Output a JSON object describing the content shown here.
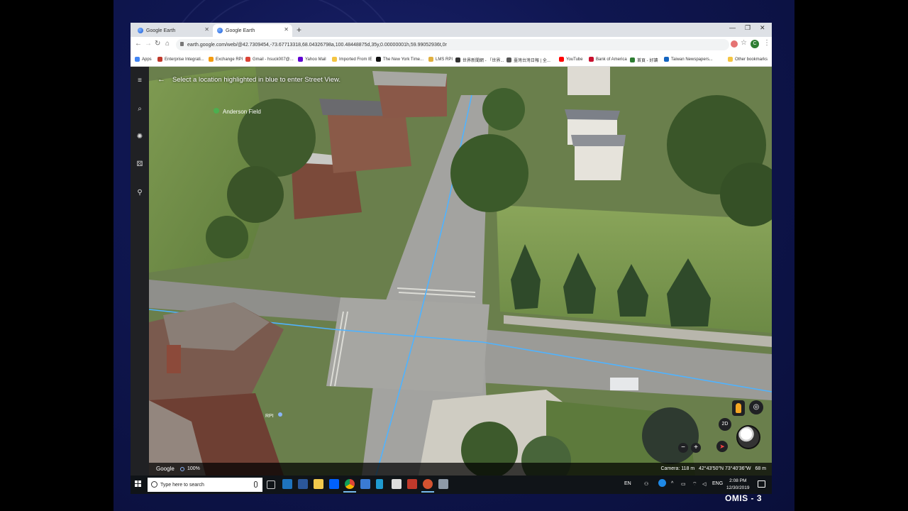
{
  "browser": {
    "tabs": [
      {
        "label": "Google Earth",
        "active": false
      },
      {
        "label": "Google Earth",
        "active": true
      }
    ],
    "url": "earth.google.com/web/@42.7309454,-73.67713318,68.04326798a,100.48448875d,35y,0.00000001h,59.99052936t,0r",
    "bookmarks": [
      {
        "label": "Apps",
        "color": "#4285f4"
      },
      {
        "label": "Enterprise Integrati...",
        "color": "#c0392b"
      },
      {
        "label": "Exchange RPI",
        "color": "#f39c12"
      },
      {
        "label": "Gmail - hsuck007@...",
        "color": "#db4437"
      },
      {
        "label": "Yahoo Mail",
        "color": "#6001d2"
      },
      {
        "label": "Imported From IE",
        "color": "#f4c542"
      },
      {
        "label": "The New York Time...",
        "color": "#111111"
      },
      {
        "label": "LMS RPI",
        "color": "#e0b040"
      },
      {
        "label": "世界新聞網 - 「世界...",
        "color": "#333333"
      },
      {
        "label": "臺灣台灣日報 | 全...",
        "color": "#555555"
      },
      {
        "label": "YouTube",
        "color": "#ff0000"
      },
      {
        "label": "Bank of America",
        "color": "#c8102e"
      },
      {
        "label": "首頁 - 好讀",
        "color": "#2e7d32"
      },
      {
        "label": "Taiwan Newspapers...",
        "color": "#1565c0"
      },
      {
        "label": "Other bookmarks",
        "color": "#f4c542"
      }
    ],
    "profile_initial": "C"
  },
  "earth": {
    "street_view_prompt": "Select a location highlighted in blue to enter Street View.",
    "place_labels": {
      "field": "Anderson Field",
      "rpi": "RPI"
    },
    "google_label": "Google",
    "loaded_pct": "100%",
    "camera": "Camera: 118 m",
    "coords": "42°43'50\"N 73°40'36\"W",
    "elevation": "68 m",
    "view_mode": "2D",
    "rail_icons": [
      "menu-icon",
      "search-icon",
      "voyager-icon",
      "dice-icon",
      "pin-icon"
    ]
  },
  "taskbar": {
    "search_placeholder": "Type here to search",
    "lang": "EN",
    "lang2": "ENG",
    "time": "2:08 PM",
    "date": "12/30/2019"
  },
  "slide": {
    "footer": "OMIS - 3",
    "colors": {
      "slide_bg": "#0f1650",
      "grass": "#6f8c45",
      "road": "#9a9a96",
      "street_view_line": "#4fb3ff"
    }
  }
}
